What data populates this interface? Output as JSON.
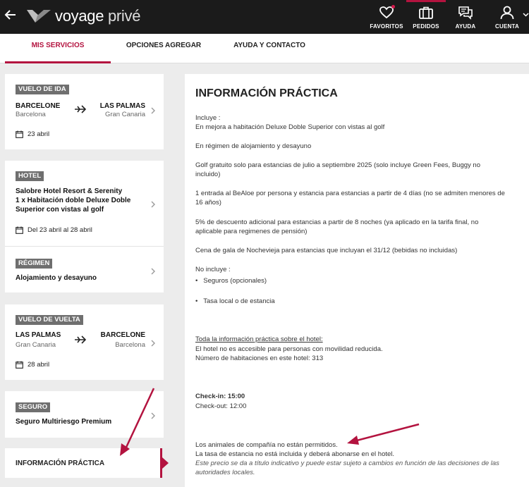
{
  "topbar": {
    "back_icon": "arrow-left-icon",
    "logo": {
      "word_bold": "voyage",
      "word_light": " privé"
    },
    "nav": [
      {
        "label": "FAVORITOS",
        "icon": "heart-icon"
      },
      {
        "label": "PEDIDOS",
        "icon": "suitcase-icon"
      },
      {
        "label": "AYUDA",
        "icon": "chat-icon"
      },
      {
        "label": "CUENTA",
        "icon": "user-icon"
      }
    ]
  },
  "tabs": [
    {
      "label": "MIS SERVICIOS"
    },
    {
      "label": "OPCIONES AGREGAR"
    },
    {
      "label": "AYUDA Y CONTACTO"
    }
  ],
  "flight_out": {
    "badge": "VUELO DE IDA",
    "from_city": "BARCELONE",
    "from_sub": "Barcelona",
    "to_city": "LAS PALMAS",
    "to_sub": "Gran Canaria",
    "date": "23 abril"
  },
  "hotel": {
    "badge": "HOTEL",
    "line1": "Salobre Hotel Resort & Serenity",
    "line2": "1 x Habitación doble Deluxe Doble",
    "line3": "Superior con vistas al golf",
    "date": "Del 23 abril al 28 abril"
  },
  "regimen": {
    "badge": "RÉGIMEN",
    "value": "Alojamiento y desayuno"
  },
  "flight_back": {
    "badge": "VUELO DE VUELTA",
    "from_city": "LAS PALMAS",
    "from_sub": "Gran Canaria",
    "to_city": "BARCELONE",
    "to_sub": "Barcelona",
    "date": "28 abril"
  },
  "insurance": {
    "badge": "SEGURO",
    "value": "Seguro Multiriesgo Premium"
  },
  "info_tab": {
    "label": "INFORMACIÓN PRÁCTICA"
  },
  "panel": {
    "title": "INFORMACIÓN PRÁCTICA",
    "includes_label": "Incluye :",
    "inc1": "En mejora a habitación Deluxe Doble Superior con vistas al golf",
    "inc2": "En régimen de alojamiento y desayuno",
    "inc3a": "Golf gratuito solo para estancias de julio a septiembre 2025 (solo incluye Green Fees, Buggy no",
    "inc3b": "incluido)",
    "inc4a": "1 entrada al BeAloe por persona y estancia para estancias a partir de 4 días (no se admiten menores de",
    "inc4b": "16 años)",
    "inc5a": "5% de descuento adicional para estancias a partir de 8 noches (ya aplicado en la tarifa final, no",
    "inc5b": "aplicable para regimenes de pensión)",
    "inc6": "Cena de gala de Nochevieja para estancias que incluyan el 31/12 (bebidas no incluidas)",
    "excludes_label": "No incluye :",
    "exc1": "Seguros (opcionales)",
    "exc2": "Tasa local o de estancia",
    "hotel_info_title": "Toda la información práctica sobre el hotel:",
    "hotel_info1": "El hotel no es accesible para personas con movilidad reducida.",
    "hotel_info2": "Número de habitaciones en este hotel: 313",
    "checkin": "Check-in: 15:00",
    "checkout": "Check-out: 12:00",
    "pets": "Los animales de compañía no están permitidos.",
    "tax": "La tasa de estancia no está incluida y deberá abonarse en el hotel.",
    "disclaimer1": "Este precio se da a título indicativo y puede estar sujeto a cambios en función de las decisiones de las",
    "disclaimer2": "autoridades locales."
  },
  "colors": {
    "accent": "#b3133f",
    "topbar": "#1b1b1b",
    "badge": "#6f6f6f"
  }
}
